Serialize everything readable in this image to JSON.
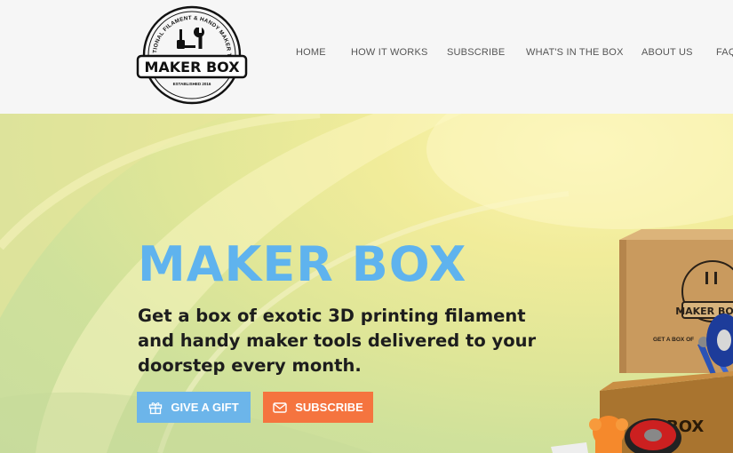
{
  "logo": {
    "arc_text": "EXCEPTIONAL FILAMENT & HANDY MAKER TOOLS",
    "name": "MAKER BOX",
    "established": "ESTABLISHED 2016"
  },
  "nav": {
    "items": [
      {
        "label": "HOME"
      },
      {
        "label": "HOW IT WORKS"
      },
      {
        "label": "SUBSCRIBE"
      },
      {
        "label": "WHAT'S IN THE BOX"
      },
      {
        "label": "ABOUT US"
      },
      {
        "label": "FAQ"
      }
    ]
  },
  "hero": {
    "title": "MAKER BOX",
    "subtitle": "Get a box of exotic 3D printing filament and handy maker tools delivered to your doorstep every month.",
    "gift_button": "GIVE A GIFT",
    "subscribe_button": "SUBSCRIBE"
  },
  "box_image": {
    "logo_text": "MAKER BOX",
    "side_text": "GET A BOX OF",
    "crate_text": "BOX"
  },
  "colors": {
    "header_bg": "#f6f6f6",
    "title_blue": "#5fb3ee",
    "gift_button": "#6cb5ea",
    "subscribe_button": "#f5743f"
  },
  "icons": {
    "gift_button": "gift-icon",
    "subscribe_button": "envelope-icon"
  }
}
